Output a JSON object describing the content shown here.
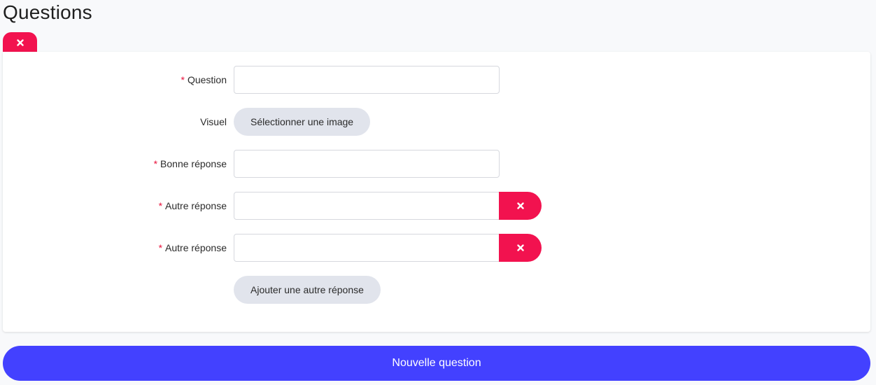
{
  "page": {
    "title": "Questions"
  },
  "icons": {
    "remove": "close-icon"
  },
  "colors": {
    "danger": "#f2124f",
    "primary": "#4341ff",
    "secondary": "#e1e4ec",
    "required_marker": "#e8123c"
  },
  "form": {
    "required_marker": "*",
    "question": {
      "label": "Question",
      "value": ""
    },
    "visual": {
      "label": "Visuel",
      "button_label": "Sélectionner une image"
    },
    "correct_answer": {
      "label": "Bonne réponse",
      "value": ""
    },
    "other_answers": [
      {
        "label": "Autre réponse",
        "value": ""
      },
      {
        "label": "Autre réponse",
        "value": ""
      }
    ],
    "add_answer_label": "Ajouter une autre réponse"
  },
  "footer": {
    "new_question_label": "Nouvelle question"
  }
}
